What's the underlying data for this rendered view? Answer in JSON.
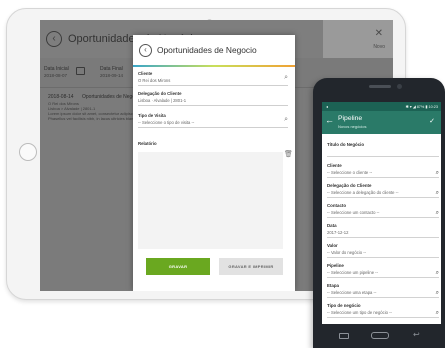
{
  "tablet": {
    "background_app": {
      "title": "Oportunidades de Negócio",
      "close_glyph": "✕",
      "new_label": "Novo",
      "filters": {
        "start_label": "Data Inicial",
        "start_value": "2018-08-07",
        "end_label": "Data Final",
        "end_value": "2018-09-14"
      },
      "list": {
        "date": "2018-08-14",
        "heading": "Oportunidades de Negócio",
        "line1": "O Rei dos Mirons",
        "line2": "Lisboa > Alvalade | 2801-1",
        "line3": "Lorem ipsum dolor sit amet, consectetur adipiscing elit sed",
        "line4": "Phasellus vel facilisis nibh, in lacus ultricies blandit"
      }
    },
    "modal": {
      "title": "Oportunidades de Negocio",
      "fields": [
        {
          "label": "Cliente",
          "value": "O Rei dos Mirons"
        },
        {
          "label": "Delegação do Cliente",
          "value": "Lisboa ∙ Alvalade | 2801-1"
        },
        {
          "label": "Tipo de Visita",
          "value": "-- Seleccione o tipo de visita --"
        }
      ],
      "report_label": "Relatório",
      "report_value": "",
      "save_button": "GRAVAR",
      "save_print_button": "GRAVAR E IMPRIMIR"
    }
  },
  "phone": {
    "status_left": "◂",
    "status_right": "✱ ▾ ◢ 87% ▮ 10:23",
    "title": "Pipeline",
    "subtitle": "Novos negócios",
    "back_glyph": "←",
    "check_glyph": "✓",
    "fields": [
      {
        "label": "Título do Negócio",
        "value": ""
      },
      {
        "label": "Cliente",
        "value": "-- Seleccione o cliente --"
      },
      {
        "label": "Delegação do Cliente",
        "value": "-- Seleccione a delegação do cliente --"
      },
      {
        "label": "Contacto",
        "value": "-- Seleccione um contacto --"
      },
      {
        "label": "Data",
        "value": "2017-12-12"
      },
      {
        "label": "Valor",
        "value": "-- Valor do negócio --"
      },
      {
        "label": "Pipeline",
        "value": "-- Seleccione um pipeline --"
      },
      {
        "label": "Etapa",
        "value": "-- Seleccione uma etapa --"
      },
      {
        "label": "Tipo de negócio",
        "value": "-- Seleccione um tipo de negócio --"
      }
    ]
  },
  "colors": {
    "phone_primary": "#2a7a68",
    "phone_statusbar": "#1c6254",
    "save_button": "#6aa820",
    "overlay": "#7b7b7b"
  },
  "icons": [
    "back-arrow-icon",
    "search-icon",
    "trash-icon",
    "calendar-icon",
    "close-icon",
    "check-icon"
  ]
}
